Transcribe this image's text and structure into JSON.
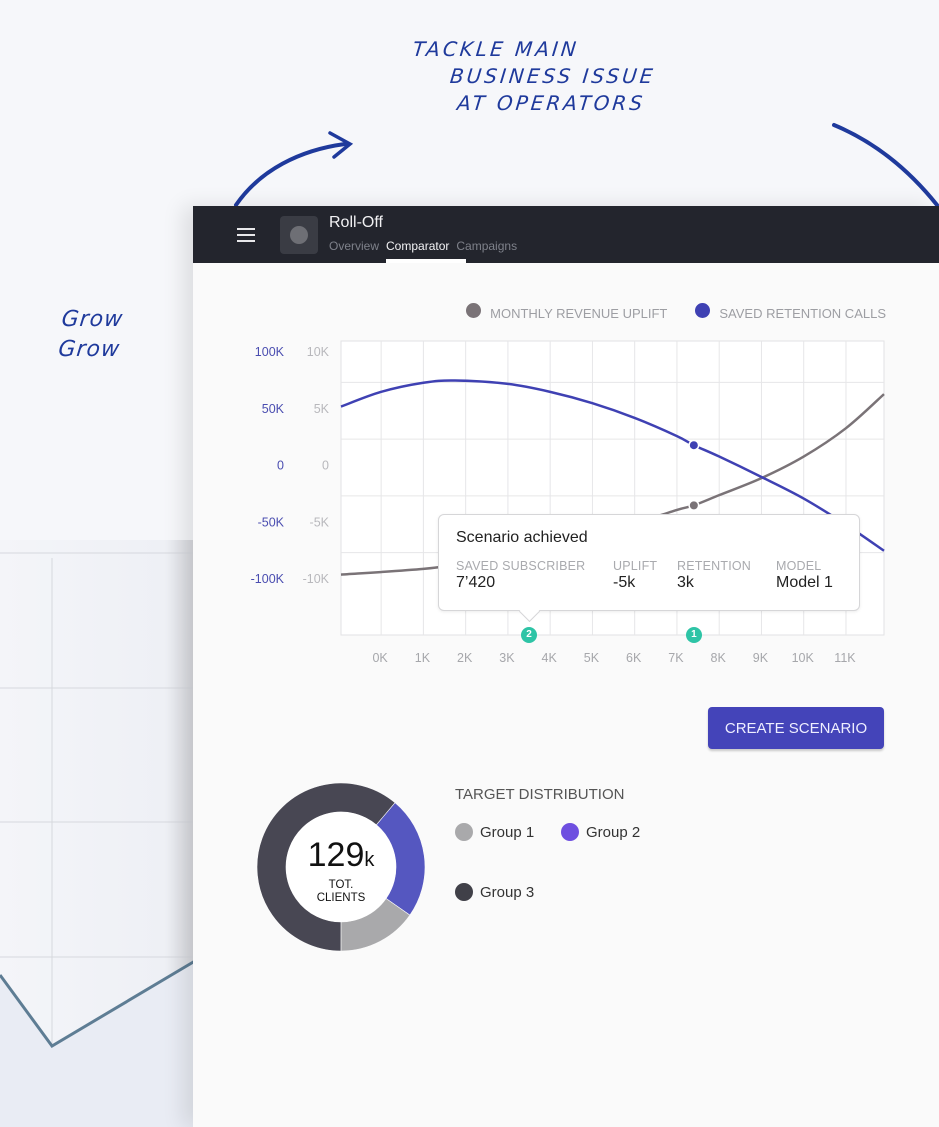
{
  "background": {
    "sketch_note_lines": [
      "TACKLE   MAIN",
      "BUSINESS  ISSUE",
      "AT OPERATORS"
    ],
    "sketch_side_lines": [
      "Grow",
      "Grow"
    ],
    "ink_color": "#1f3a9c"
  },
  "app": {
    "title": "Roll-Off",
    "tabs": [
      {
        "label": "Overview",
        "active": false
      },
      {
        "label": "Comparator",
        "active": true
      },
      {
        "label": "Campaigns",
        "active": false
      }
    ]
  },
  "chart_data": {
    "type": "line",
    "title": "",
    "legend_position": "top-right",
    "grid": true,
    "xlabel": "",
    "x_ticks": [
      "0K",
      "1K",
      "2K",
      "3K",
      "4K",
      "5K",
      "6K",
      "7K",
      "8K",
      "9K",
      "10K",
      "11K"
    ],
    "xlim": [
      -0.95,
      11.9
    ],
    "y_left": {
      "ticks": [
        "100K",
        "50K",
        "0",
        "-50K",
        "-100K"
      ],
      "range": [
        -100000,
        100000
      ],
      "color": "#4a4db0"
    },
    "y_right": {
      "ticks": [
        "10K",
        "5K",
        "0",
        "-5K",
        "-10K"
      ],
      "range": [
        -10000,
        10000
      ],
      "color": "#b8b8bc"
    },
    "series": [
      {
        "name": "MONTHLY REVENUE UPLIFT",
        "axis": "right",
        "color": "#7a7377",
        "x": [
          -0.95,
          1,
          2,
          3,
          4,
          5,
          6,
          7,
          7.4,
          8,
          9,
          10,
          11,
          11.9
        ],
        "y": [
          -9700,
          -9200,
          -8700,
          -8000,
          -7200,
          -6300,
          -5200,
          -4000,
          -3600,
          -2700,
          -1200,
          700,
          3200,
          6200
        ]
      },
      {
        "name": "SAVED RETENTION CALLS",
        "axis": "left",
        "color": "#3f41b3",
        "x": [
          -0.95,
          0,
          1,
          1.75,
          3,
          4,
          5,
          6,
          7,
          7.4,
          8,
          9,
          10,
          11,
          11.9
        ],
        "y": [
          51000,
          64000,
          72000,
          74000,
          71000,
          64000,
          54000,
          41000,
          25000,
          17000,
          7000,
          -11000,
          -30000,
          -53000,
          -76000
        ]
      }
    ],
    "highlight_points": [
      {
        "x": 7.4,
        "series": "both"
      }
    ],
    "scenario_markers": [
      {
        "label": "2",
        "x": 3.5
      },
      {
        "label": "1",
        "x": 7.4
      }
    ]
  },
  "tooltip": {
    "title": "Scenario achieved",
    "columns": [
      {
        "label": "SAVED SUBSCRIBER",
        "value": "7’420"
      },
      {
        "label": "UPLIFT",
        "value": "-5k"
      },
      {
        "label": "RETENTION",
        "value": "3k"
      },
      {
        "label": "MODEL",
        "value": "Model 1"
      }
    ]
  },
  "actions": {
    "create_scenario": "CREATE SCENARIO"
  },
  "distribution": {
    "title": "TARGET DISTRIBUTION",
    "total_value": "129",
    "total_unit": "k",
    "total_label_1": "TOT.",
    "total_label_2": "CLIENTS",
    "groups": [
      {
        "label": "Group 1",
        "color": "#a9a9ab",
        "share": 0.153
      },
      {
        "label": "Group 2",
        "color": "#5557c0",
        "share": 0.236
      },
      {
        "label": "Group 3",
        "color": "#484753",
        "share": 0.611
      }
    ],
    "legend_dot_colors": {
      "Group 1": "#a9a9ab",
      "Group 2": "#6e4fe0",
      "Group 3": "#404048"
    }
  }
}
